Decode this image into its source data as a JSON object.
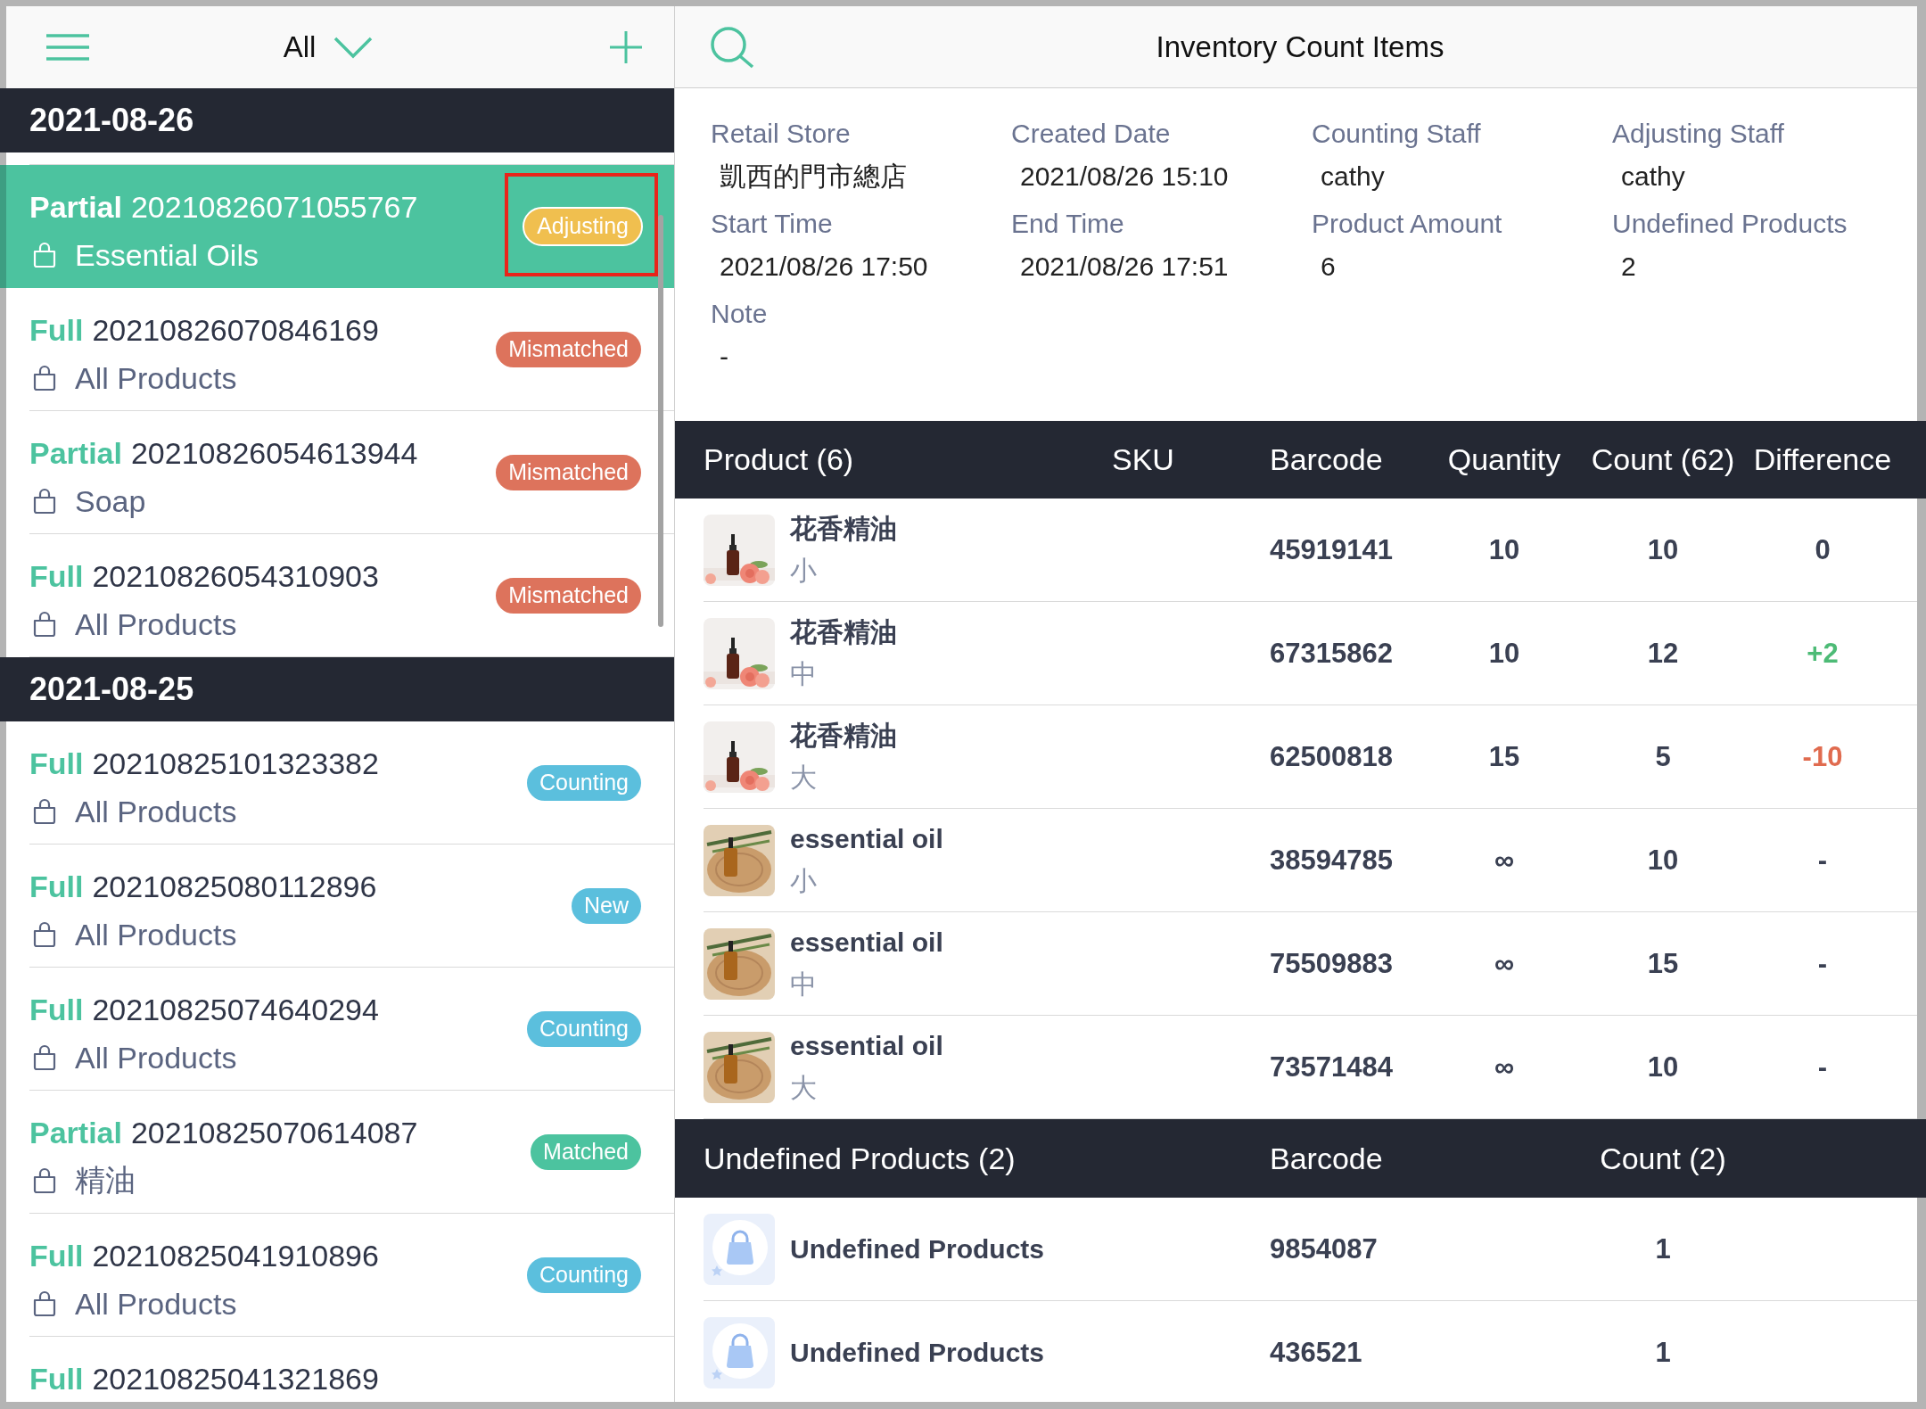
{
  "sidebar": {
    "filter": "All",
    "sections": [
      {
        "date": "2021-08-26",
        "rows": [
          {
            "type": "Partial",
            "number": "20210826071055767",
            "scope": "Essential Oils",
            "status": "Adjusting",
            "color": "#f0bf4f",
            "selected": true,
            "highlighted": true
          },
          {
            "type": "Full",
            "number": "20210826070846169",
            "scope": "All Products",
            "status": "Mismatched",
            "color": "#dd735c",
            "selected": false,
            "highlighted": false
          },
          {
            "type": "Partial",
            "number": "20210826054613944",
            "scope": "Soap",
            "status": "Mismatched",
            "color": "#dd735c",
            "selected": false,
            "highlighted": false
          },
          {
            "type": "Full",
            "number": "20210826054310903",
            "scope": "All Products",
            "status": "Mismatched",
            "color": "#dd735c",
            "selected": false,
            "highlighted": false
          }
        ]
      },
      {
        "date": "2021-08-25",
        "rows": [
          {
            "type": "Full",
            "number": "20210825101323382",
            "scope": "All Products",
            "status": "Counting",
            "color": "#5bbfdd",
            "selected": false,
            "highlighted": false
          },
          {
            "type": "Full",
            "number": "20210825080112896",
            "scope": "All Products",
            "status": "New",
            "color": "#5bbfdd",
            "selected": false,
            "highlighted": false
          },
          {
            "type": "Full",
            "number": "20210825074640294",
            "scope": "All Products",
            "status": "Counting",
            "color": "#5bbfdd",
            "selected": false,
            "highlighted": false
          },
          {
            "type": "Partial",
            "number": "20210825070614087",
            "scope": "精油",
            "status": "Matched",
            "color": "#4cc39f",
            "selected": false,
            "highlighted": false
          },
          {
            "type": "Full",
            "number": "20210825041910896",
            "scope": "All Products",
            "status": "Counting",
            "color": "#5bbfdd",
            "selected": false,
            "highlighted": false
          },
          {
            "type": "Full",
            "number": "20210825041321869",
            "selected": false,
            "highlighted": false
          }
        ]
      }
    ]
  },
  "detail": {
    "title": "Inventory Count Items",
    "fields": [
      {
        "label": "Retail Store",
        "value": "凱西的門市總店"
      },
      {
        "label": "Created Date",
        "value": "2021/08/26 15:10"
      },
      {
        "label": "Counting Staff",
        "value": "cathy"
      },
      {
        "label": "Adjusting Staff",
        "value": "cathy"
      },
      {
        "label": "Start Time",
        "value": "2021/08/26 17:50"
      },
      {
        "label": "End Time",
        "value": "2021/08/26 17:51"
      },
      {
        "label": "Product Amount",
        "value": "6"
      },
      {
        "label": "Undefined Products",
        "value": "2"
      },
      {
        "label": "Note",
        "value": "-"
      }
    ],
    "products": {
      "columns": [
        "Product (6)",
        "SKU",
        "Barcode",
        "Quantity",
        "Count (62)",
        "Difference"
      ],
      "rows": [
        {
          "kind": "rose",
          "name": "花香精油",
          "variant": "小",
          "barcode": "45919141",
          "quantity": "10",
          "count": "10",
          "difference": "0",
          "color": "#3a4052"
        },
        {
          "kind": "rose",
          "name": "花香精油",
          "variant": "中",
          "barcode": "67315862",
          "quantity": "10",
          "count": "12",
          "difference": "+2",
          "color": "#4dbb76"
        },
        {
          "kind": "rose",
          "name": "花香精油",
          "variant": "大",
          "barcode": "62500818",
          "quantity": "15",
          "count": "5",
          "difference": "-10",
          "color": "#e06b4f"
        },
        {
          "kind": "wood",
          "name": "essential oil",
          "variant": "小",
          "barcode": "38594785",
          "quantity": "∞",
          "count": "10",
          "difference": "-",
          "color": "#3a4052"
        },
        {
          "kind": "wood",
          "name": "essential oil",
          "variant": "中",
          "barcode": "75509883",
          "quantity": "∞",
          "count": "15",
          "difference": "-",
          "color": "#3a4052"
        },
        {
          "kind": "wood",
          "name": "essential oil",
          "variant": "大",
          "barcode": "73571484",
          "quantity": "∞",
          "count": "10",
          "difference": "-",
          "color": "#3a4052"
        }
      ]
    },
    "undefined_products": {
      "columns": [
        "Undefined Products (2)",
        "Barcode",
        "Count (2)"
      ],
      "rows": [
        {
          "name": "Undefined Products",
          "barcode": "9854087",
          "count": "1"
        },
        {
          "name": "Undefined Products",
          "barcode": "436521",
          "count": "1"
        }
      ]
    }
  }
}
